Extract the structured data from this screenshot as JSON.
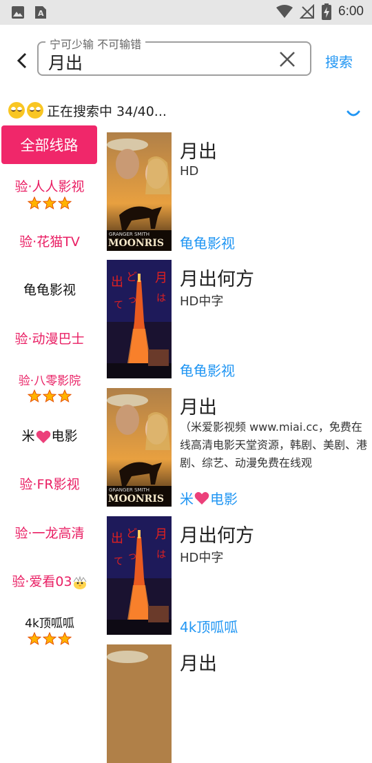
{
  "status_bar": {
    "time": "6:00",
    "icons": [
      "image-icon",
      "a-text-icon",
      "wifi-icon",
      "no-signal-icon",
      "battery-charging-icon"
    ]
  },
  "search": {
    "legend": "宁可少输 不可输错",
    "value": "月出",
    "button_label": "搜索"
  },
  "progress": {
    "text": "正在搜索中 34/40..."
  },
  "sidebar": {
    "all_label": "全部线路",
    "items": [
      {
        "label": "验·人人影视",
        "stars": 3,
        "color": "pink"
      },
      {
        "label": "验·花猫TV",
        "stars": 0,
        "color": "pink"
      },
      {
        "label": "龟龟影视",
        "stars": 0,
        "color": "black"
      },
      {
        "label": "验·动漫巴士",
        "stars": 0,
        "color": "pink"
      },
      {
        "label": "验·八零影院",
        "stars": 3,
        "color": "pink"
      },
      {
        "label_pre": "米",
        "label_post": "电影",
        "stars": 0,
        "color": "black"
      },
      {
        "label": "验·FR影视",
        "stars": 0,
        "color": "pink"
      },
      {
        "label": "验·一龙高清",
        "stars": 0,
        "color": "pink"
      },
      {
        "label": "验·爱看03",
        "stars": 0,
        "color": "pink"
      },
      {
        "label": "4k顶呱呱",
        "stars": 3,
        "color": "black"
      }
    ]
  },
  "results": [
    {
      "title": "月出",
      "subtitle": "HD",
      "source": "龟龟影视",
      "poster": "moonrise",
      "poster_text": "GRANGER SMITH",
      "poster_title": "MOONRIS"
    },
    {
      "title": "月出何方",
      "subtitle": "HD中字",
      "source": "龟龟影视",
      "poster": "tower"
    },
    {
      "title": "月出",
      "description": "（米爱影视频 www.miai.cc，免费在线高清电影天堂资源，韩剧、美剧、港剧、综艺、动漫免费在线观",
      "source_pre": "米",
      "source_post": "电影",
      "poster": "moonrise",
      "poster_text": "GRANGER SMITH",
      "poster_title": "MOONRIS"
    },
    {
      "title": "月出何方",
      "subtitle": "HD中字",
      "source": "4k顶呱呱",
      "poster": "tower"
    },
    {
      "title": "月出",
      "poster": "moonrise"
    }
  ],
  "colors": {
    "accent_pink": "#e91e63",
    "link_blue": "#2196f3",
    "all_button": "#f0276a"
  }
}
